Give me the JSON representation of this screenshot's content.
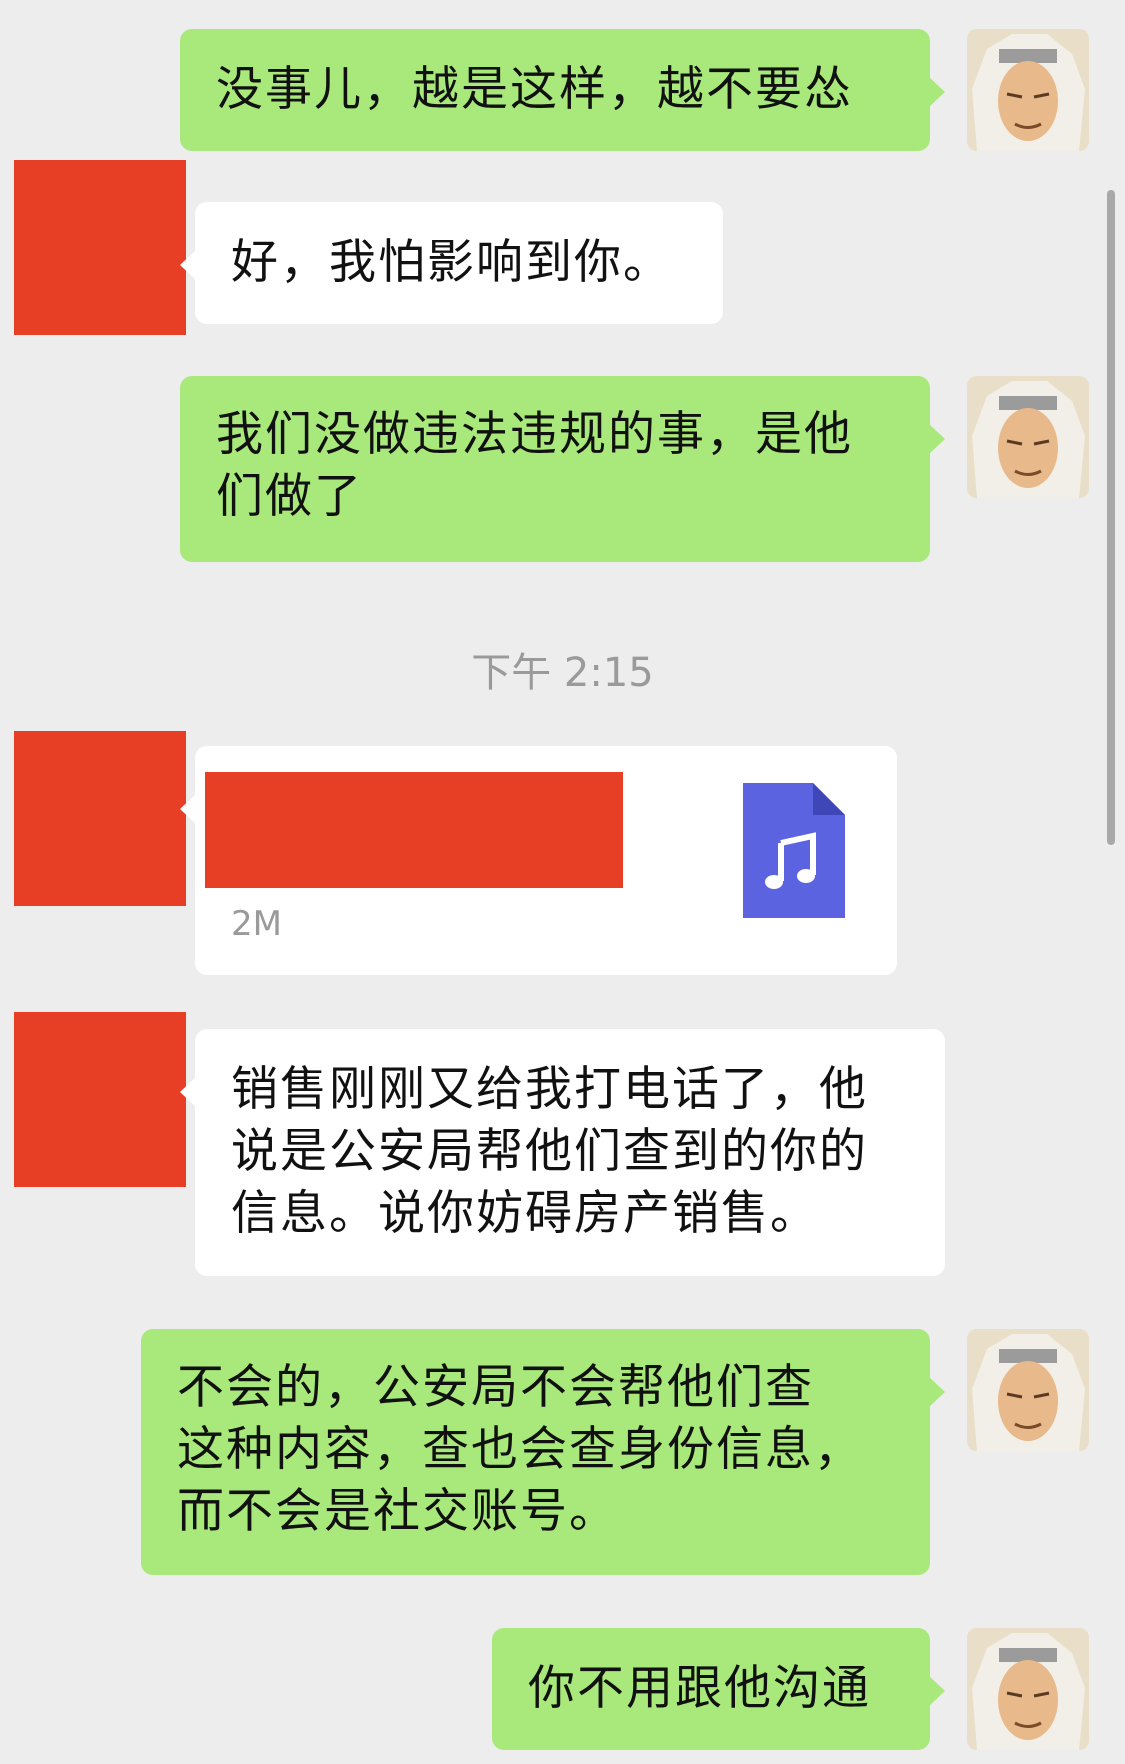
{
  "messages": [
    {
      "side": "right",
      "text": "没事儿，越是这样，越不要怂"
    },
    {
      "side": "left",
      "text": "好，我怕影响到你。"
    },
    {
      "side": "right",
      "text": "我们没做违法违规的事，是他\n们做了"
    },
    {
      "side": "left",
      "text": "销售刚刚又给我打电话了，他\n说是公安局帮他们查到的你的\n信息。说你妨碍房产销售。"
    },
    {
      "side": "right",
      "text": "不会的，公安局不会帮他们查\n这种内容，查也会查身份信息，\n而不会是社交账号。"
    },
    {
      "side": "right",
      "text": "你不用跟他沟通"
    }
  ],
  "timestamp": "下午 2:15",
  "file": {
    "size": "2M",
    "icon": "music-file-icon"
  },
  "colors": {
    "background": "#ededed",
    "self_bubble": "#a9e97b",
    "other_bubble": "#ffffff",
    "redaction": "#e63f25",
    "file_icon": "#5b63e0"
  }
}
